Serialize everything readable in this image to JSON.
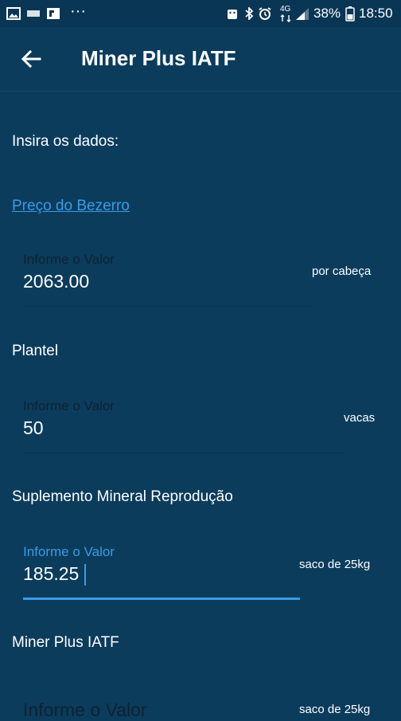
{
  "status_bar": {
    "battery": "38%",
    "time": "18:50",
    "network": "4G"
  },
  "app_bar": {
    "title": "Miner Plus IATF"
  },
  "form": {
    "intro": "Insira os dados:",
    "link_label": "Preço do Bezerro",
    "fields": [
      {
        "label": "",
        "placeholder": "Informe o Valor",
        "value": "2063.00",
        "unit": "por cabeça"
      },
      {
        "label": "Plantel",
        "placeholder": "Informe o Valor",
        "value": "50",
        "unit": "vacas"
      },
      {
        "label": "Suplemento Mineral Reprodução",
        "placeholder": "Informe o Valor",
        "value": "185.25",
        "unit": "saco de 25kg"
      },
      {
        "label": "Miner Plus IATF",
        "placeholder": "Informe o Valor",
        "value": "",
        "unit": "saco de 25kg"
      }
    ]
  }
}
